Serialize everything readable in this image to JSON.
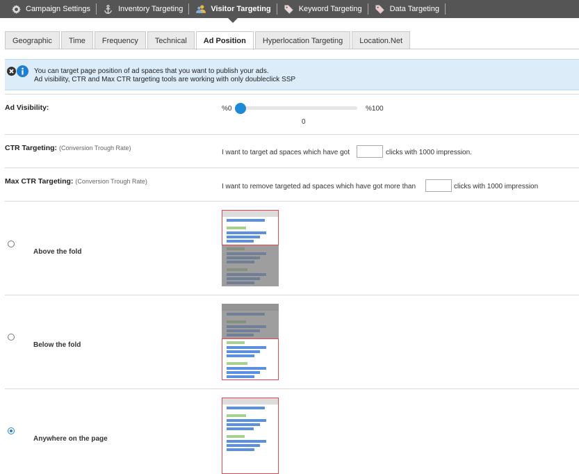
{
  "topnav": {
    "items": [
      {
        "label": "Campaign Settings"
      },
      {
        "label": "Inventory Targeting"
      },
      {
        "label": "Visitor Targeting"
      },
      {
        "label": "Keyword Targeting"
      },
      {
        "label": "Data Targeting"
      }
    ],
    "active_index": 2
  },
  "subtabs": {
    "items": [
      "Geographic",
      "Time",
      "Frequency",
      "Technical",
      "Ad Position",
      "Hyperlocation Targeting",
      "Location.Net"
    ],
    "active_index": 4
  },
  "info": {
    "line1": "You can target page position of ad spaces that you want to publish your ads.",
    "line2": "Ad visibility, CTR and Max CTR targeting tools are working with only doubleclick SSP"
  },
  "ad_visibility": {
    "label": "Ad Visibility:",
    "min_label": "%0",
    "max_label": "%100",
    "value_text": "0",
    "value": 0
  },
  "ctr": {
    "label": "CTR Targeting:",
    "sublabel": "(Conversion Trough Rate)",
    "text_before": "I want to target ad spaces which have got",
    "text_after": "clicks with 1000 impression.",
    "input_value": ""
  },
  "max_ctr": {
    "label": "Max CTR Targeting:",
    "sublabel": "(Conversion Trough Rate)",
    "text_before": "I want to remove targeted ad spaces which have got more than",
    "text_after": "clicks with 1000 impression",
    "input_value": ""
  },
  "positions": [
    {
      "label": "Above the fold",
      "checked": false
    },
    {
      "label": "Below the fold",
      "checked": false
    },
    {
      "label": "Anywhere on the page",
      "checked": true
    }
  ],
  "colors": {
    "accent": "#1e7fd0",
    "highlight_border": "#e0474c",
    "topbar": "#555555",
    "info_bg": "#dcecf8"
  }
}
